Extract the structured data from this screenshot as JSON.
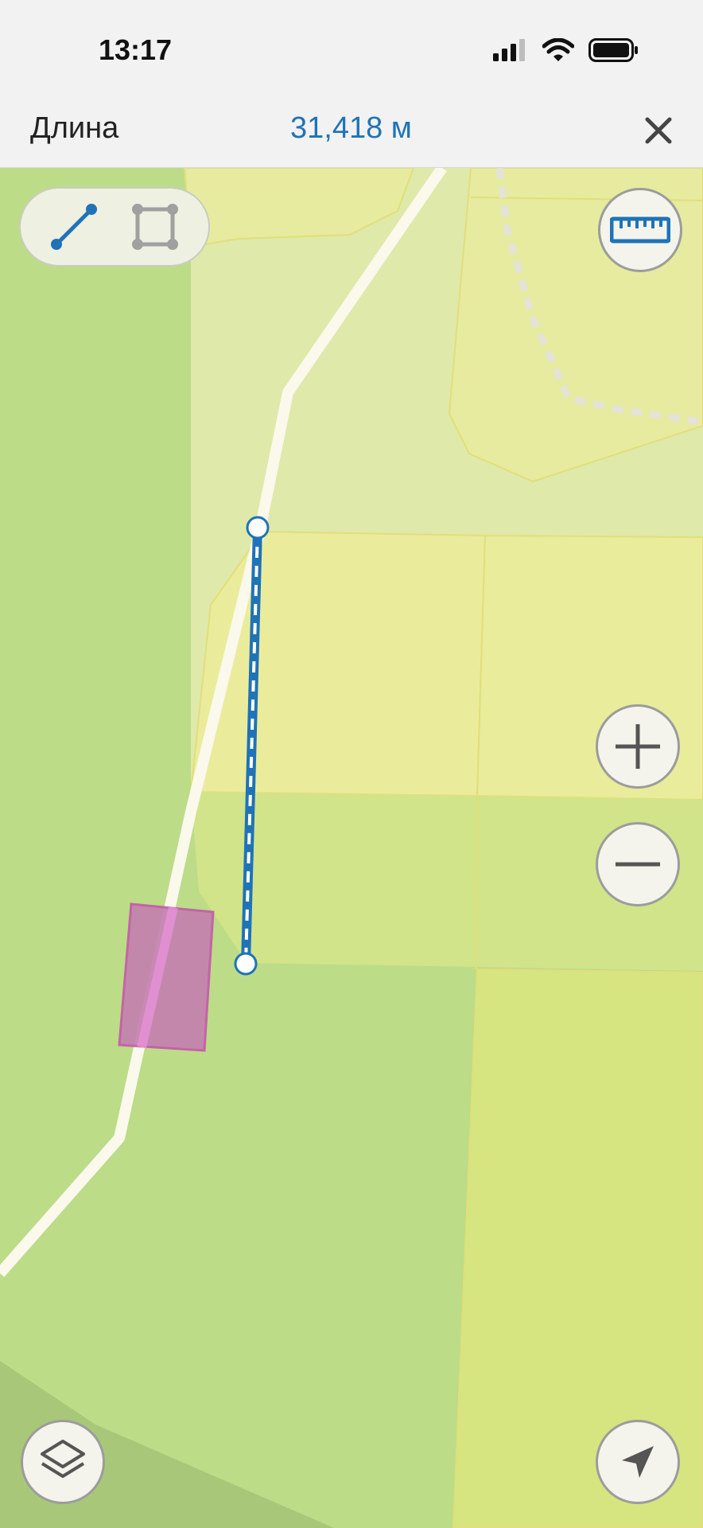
{
  "status_bar": {
    "time": "13:17"
  },
  "header": {
    "title": "Длина",
    "measurement": "31,418 м"
  },
  "colors": {
    "accent": "#1f73b7",
    "map_green": "#bcdc88",
    "map_yellow": "#e8ec9a",
    "road": "#fbf8ec",
    "highlight": "#c98bb2"
  },
  "icons": {
    "line_mode": "line-segment-icon",
    "area_mode": "polygon-square-icon",
    "ruler": "ruler-icon",
    "zoom_in": "plus-icon",
    "zoom_out": "minus-icon",
    "layers": "layers-icon",
    "location": "navigation-arrow-icon",
    "close": "close-x-icon"
  }
}
